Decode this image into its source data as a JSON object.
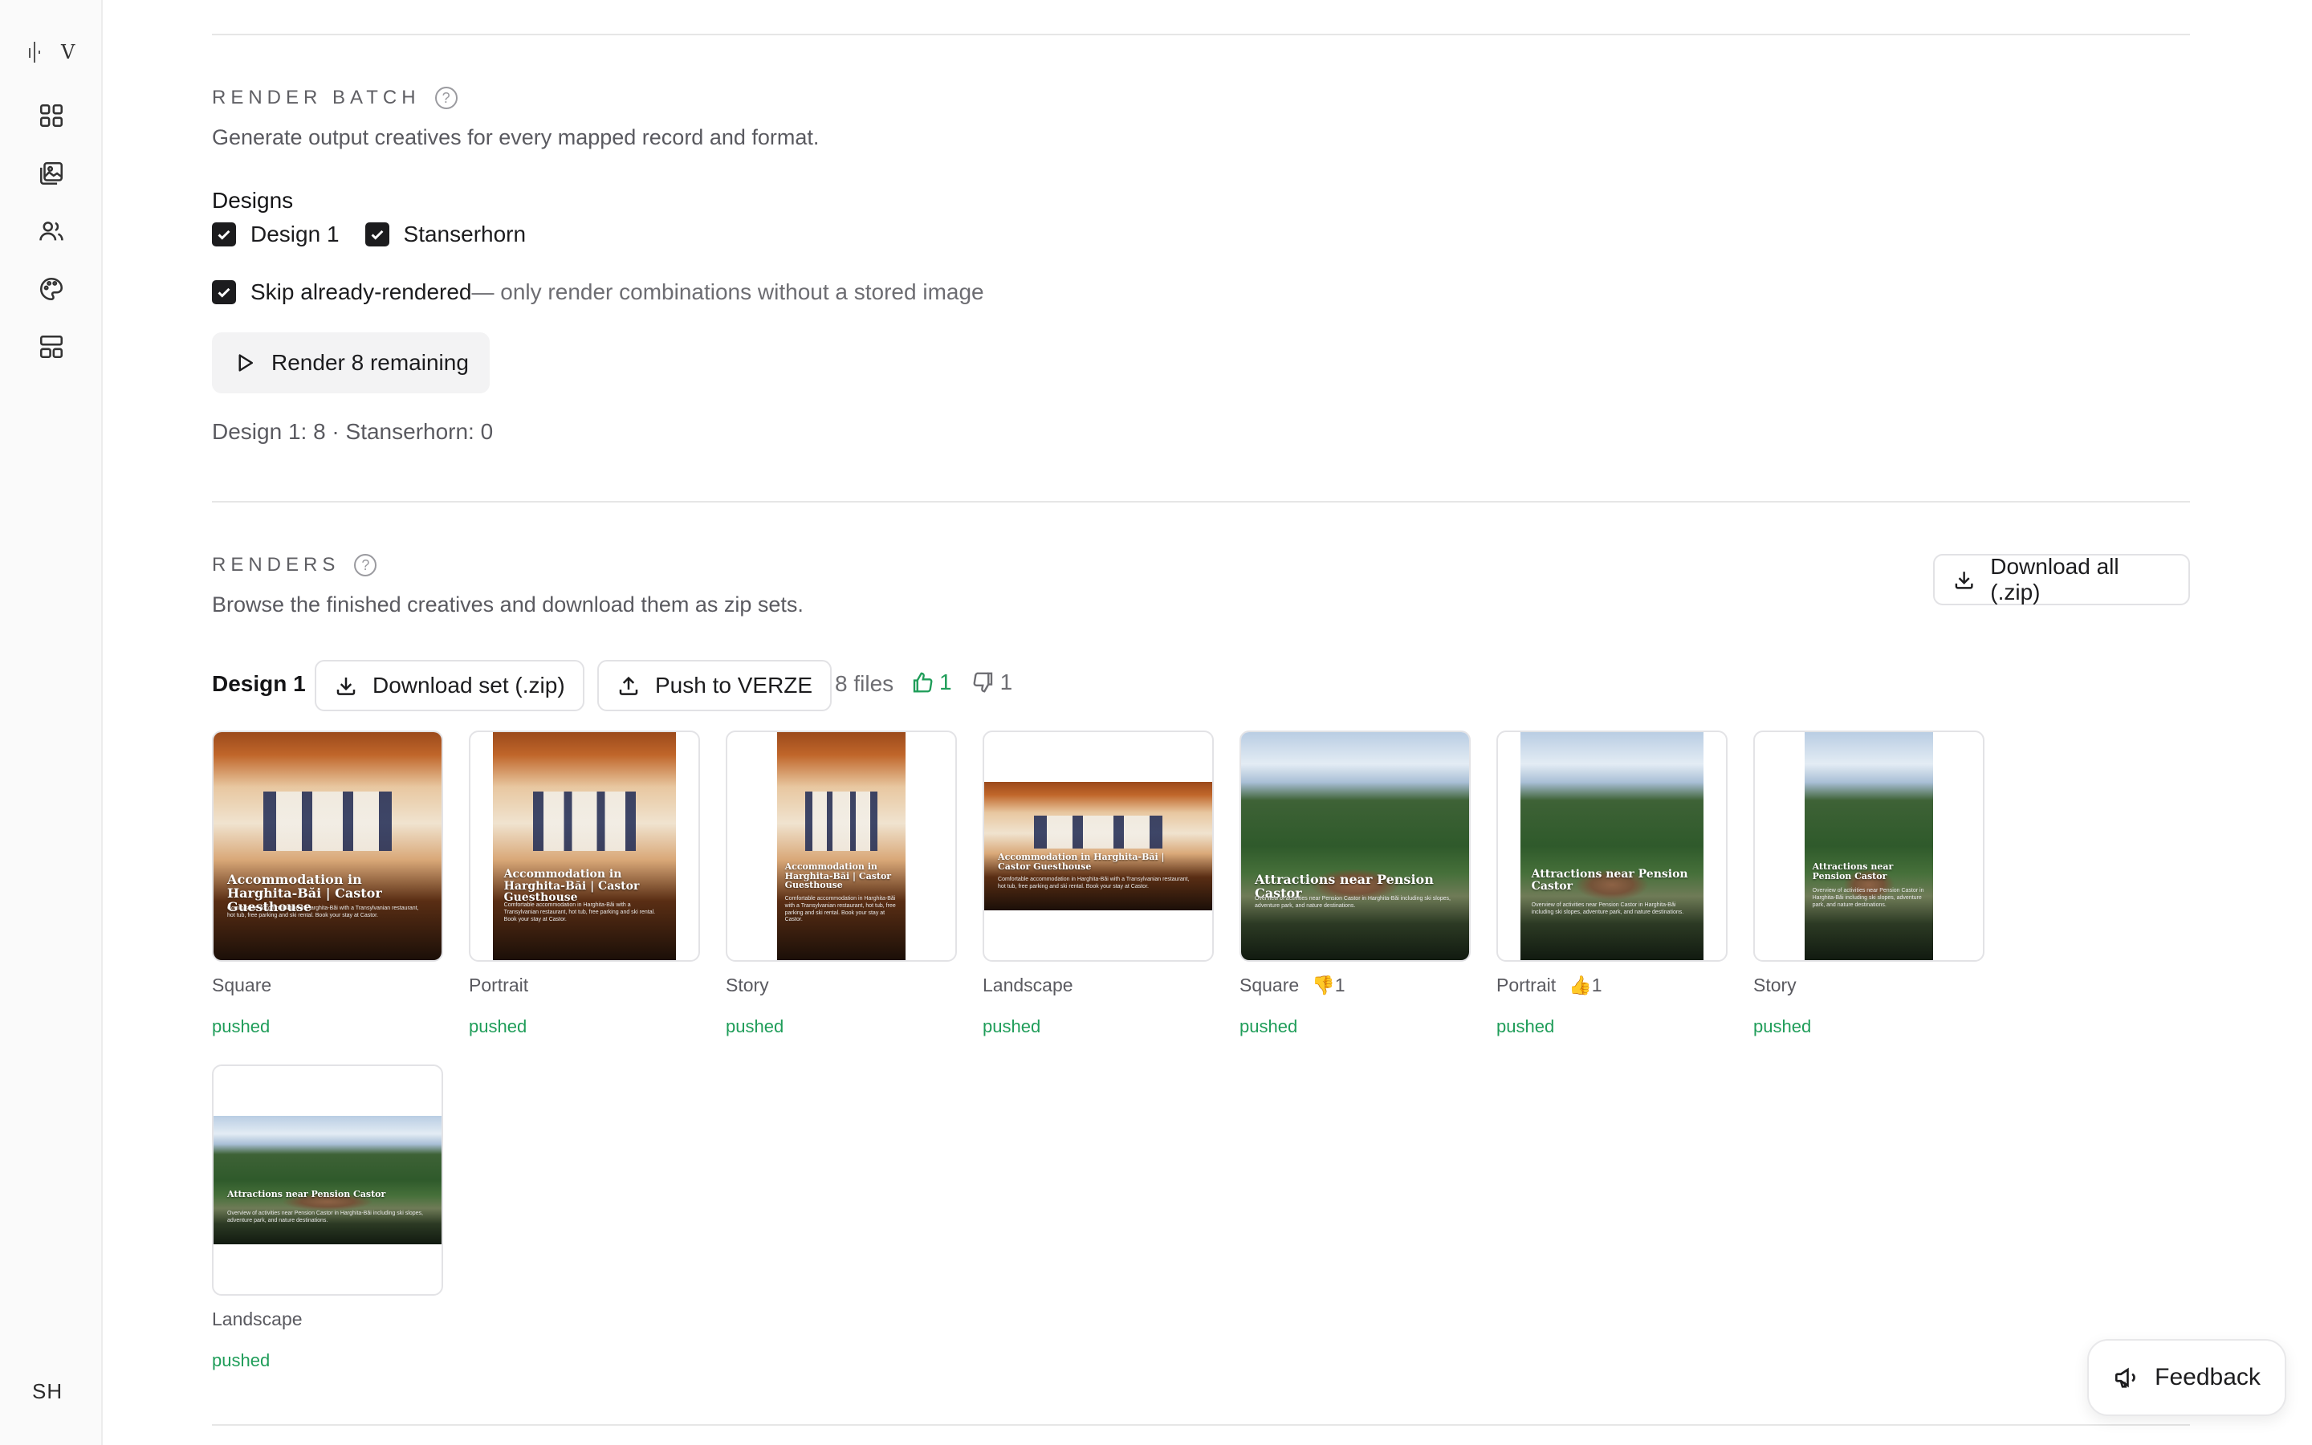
{
  "sidebar": {
    "logo_letter": "V",
    "icons": [
      "dashboard-icon",
      "gallery-icon",
      "users-icon",
      "palette-icon",
      "layout-icon"
    ],
    "avatar": "SH"
  },
  "render_batch": {
    "title": "RENDER BATCH",
    "help": "?",
    "description": "Generate output creatives for every mapped record and format.",
    "designs_label": "Designs",
    "designs": [
      {
        "label": "Design 1",
        "checked": true
      },
      {
        "label": "Stanserhorn",
        "checked": true
      }
    ],
    "skip_label": "Skip already-rendered",
    "skip_note": " — only render combinations without a stored image",
    "render_button": "Render 8 remaining",
    "counts": "Design 1: 8 · Stanserhorn: 0"
  },
  "renders": {
    "title": "RENDERS",
    "help": "?",
    "description": "Browse the finished creatives and download them as zip sets.",
    "download_all": "Download all (.zip)",
    "group": {
      "name": "Design 1",
      "download_set": "Download set (.zip)",
      "push": "Push to VERZE",
      "files": "8 files",
      "thumbs_up": "1",
      "thumbs_down": "1"
    },
    "items": [
      {
        "format": "Square",
        "status": "pushed",
        "vote": "",
        "caption": "Accommodation in Harghita-Băi | Castor Guesthouse",
        "subtext": "Comfortable accommodation in Harghita-Băi with a Transylvanian restaurant, hot tub, free parking and ski rental. Book your stay at Castor."
      },
      {
        "format": "Portrait",
        "status": "pushed",
        "vote": "",
        "caption": "Accommodation in Harghita-Băi | Castor Guesthouse",
        "subtext": "Comfortable accommodation in Harghita-Băi with a Transylvanian restaurant, hot tub, free parking and ski rental. Book your stay at Castor."
      },
      {
        "format": "Story",
        "status": "pushed",
        "vote": "",
        "caption": "Accommodation in Harghita-Băi | Castor Guesthouse",
        "subtext": "Comfortable accommodation in Harghita-Băi with a Transylvanian restaurant, hot tub, free parking and ski rental. Book your stay at Castor."
      },
      {
        "format": "Landscape",
        "status": "pushed",
        "vote": "",
        "caption": "Accommodation in Harghita-Băi | Castor Guesthouse",
        "subtext": "Comfortable accommodation in Harghita-Băi with a Transylvanian restaurant, hot tub, free parking and ski rental. Book your stay at Castor."
      },
      {
        "format": "Square",
        "status": "pushed",
        "vote": "👎1",
        "caption": "Attractions near Pension Castor",
        "subtext": "Overview of activities near Pension Castor in Harghita-Băi including ski slopes, adventure park, and nature destinations."
      },
      {
        "format": "Portrait",
        "status": "pushed",
        "vote": "👍1",
        "caption": "Attractions near Pension Castor",
        "subtext": "Overview of activities near Pension Castor in Harghita-Băi including ski slopes, adventure park, and nature destinations."
      },
      {
        "format": "Story",
        "status": "pushed",
        "vote": "",
        "caption": "Attractions near Pension Castor",
        "subtext": "Overview of activities near Pension Castor in Harghita-Băi including ski slopes, adventure park, and nature destinations."
      },
      {
        "format": "Landscape",
        "status": "pushed",
        "vote": "",
        "caption": "Attractions near Pension Castor",
        "subtext": "Overview of activities near Pension Castor in Harghita-Băi including ski slopes, adventure park, and nature destinations."
      }
    ]
  },
  "feedback": "Feedback",
  "colors": {
    "pushed": "#1f9d59",
    "checkbox": "#1c1c1e",
    "accent_up": "#1f9d59"
  }
}
